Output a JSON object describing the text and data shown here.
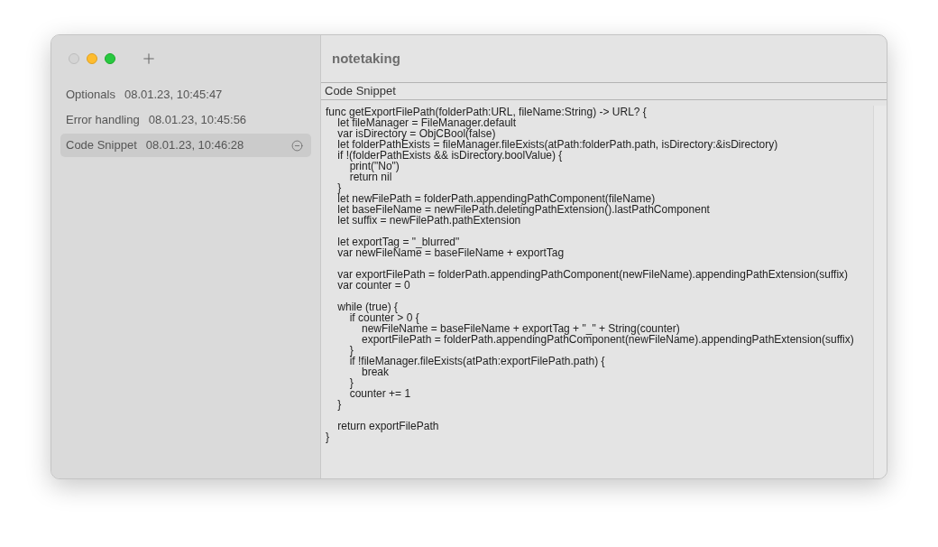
{
  "window": {
    "title": "notetaking",
    "traffic_lights": [
      {
        "kind": "close",
        "disabled": true
      },
      {
        "kind": "minimize",
        "disabled": false
      },
      {
        "kind": "zoom",
        "disabled": false
      }
    ]
  },
  "sidebar": {
    "notes": [
      {
        "title": "Optionals",
        "date": "08.01.23, 10:45:47",
        "selected": false
      },
      {
        "title": "Error handling",
        "date": "08.01.23, 10:45:56",
        "selected": false
      },
      {
        "title": "Code Snippet",
        "date": "08.01.23, 10:46:28",
        "selected": true
      }
    ]
  },
  "editor": {
    "note_title": "Code Snippet",
    "body": "func getExportFilePath(folderPath:URL, fileName:String) -> URL? {\n    let fileManager = FileManager.default\n    var isDirectory = ObjCBool(false)\n    let folderPathExists = fileManager.fileExists(atPath:folderPath.path, isDirectory:&isDirectory)\n    if !(folderPathExists && isDirectory.boolValue) {\n        print(\"No\")\n        return nil\n    }\n    let newFilePath = folderPath.appendingPathComponent(fileName)\n    let baseFileName = newFilePath.deletingPathExtension().lastPathComponent\n    let suffix = newFilePath.pathExtension\n\n    let exportTag = \"_blurred\"\n    var newFileName = baseFileName + exportTag\n\n    var exportFilePath = folderPath.appendingPathComponent(newFileName).appendingPathExtension(suffix)\n    var counter = 0\n\n    while (true) {\n        if counter > 0 {\n            newFileName = baseFileName + exportTag + \"_\" + String(counter)\n            exportFilePath = folderPath.appendingPathComponent(newFileName).appendingPathExtension(suffix)\n        }\n        if !fileManager.fileExists(atPath:exportFilePath.path) {\n            break\n        }\n        counter += 1\n    }\n\n    return exportFilePath\n}"
  }
}
